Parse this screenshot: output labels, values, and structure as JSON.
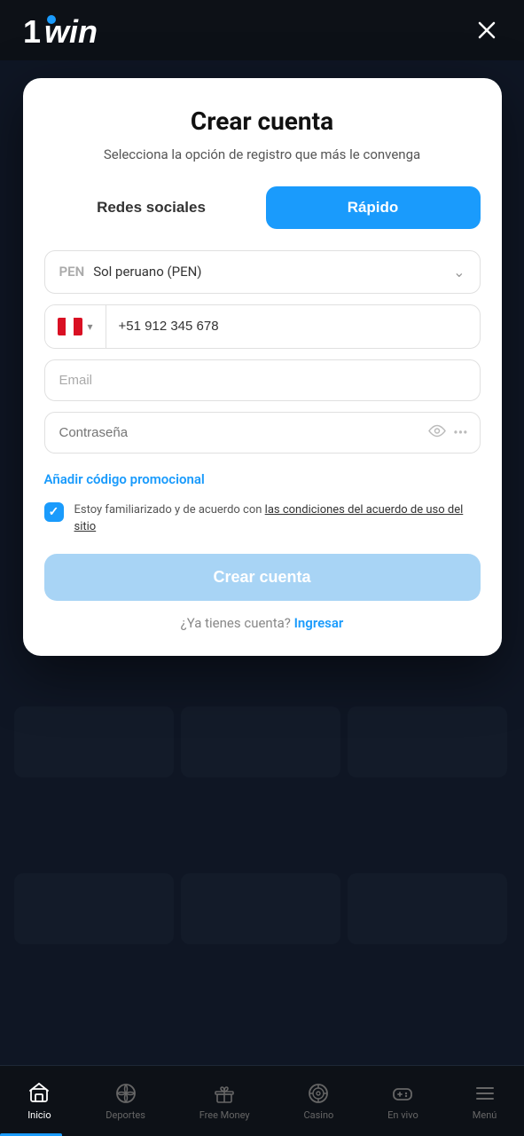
{
  "header": {
    "logo": "1win",
    "close_label": "×"
  },
  "modal": {
    "title": "Crear cuenta",
    "subtitle": "Selecciona la opción de registro que más le convenga",
    "tab_social": "Redes sociales",
    "tab_rapid": "Rápido",
    "currency_code": "PEN",
    "currency_name": "Sol peruano (PEN)",
    "phone_code": "+51",
    "phone_placeholder": "912 345 678",
    "email_placeholder": "Email",
    "password_placeholder": "Contraseña",
    "promo_label": "Añadir código promocional",
    "checkbox_text": "Estoy familiarizado y de acuerdo con ",
    "checkbox_link": "las condiciones del acuerdo de uso del sitio",
    "create_btn": "Crear cuenta",
    "login_prompt": "¿Ya tienes cuenta?",
    "login_link": "Ingresar"
  },
  "bottom_nav": {
    "items": [
      {
        "id": "inicio",
        "label": "Inicio",
        "active": true
      },
      {
        "id": "deportes",
        "label": "Deportes",
        "active": false
      },
      {
        "id": "free-money",
        "label": "Free Money",
        "active": false
      },
      {
        "id": "casino",
        "label": "Casino",
        "active": false
      },
      {
        "id": "en-vivo",
        "label": "En vivo",
        "active": false
      },
      {
        "id": "menu",
        "label": "Menú",
        "active": false
      }
    ]
  }
}
